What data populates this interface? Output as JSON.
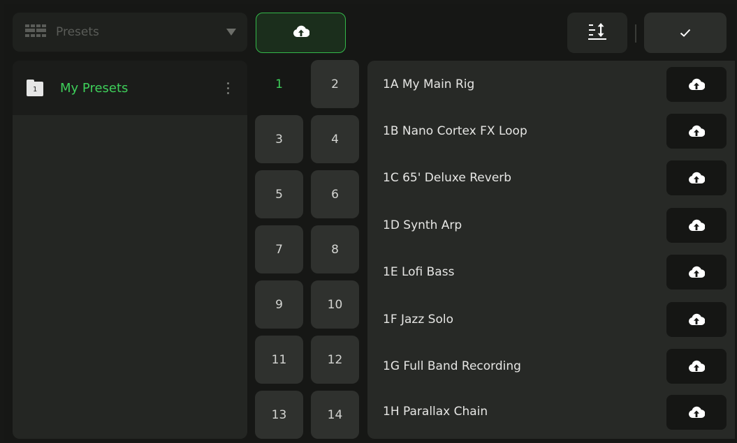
{
  "toolbar": {
    "preset_dropdown_label": "Presets",
    "grid_icon": "preset-grid-icon",
    "upload_icon": "cloud-upload-icon",
    "sort_icon": "sort-icon",
    "confirm_icon": "checkmark-icon"
  },
  "folders": [
    {
      "number": "1",
      "name": "My Presets"
    }
  ],
  "banks": [
    "1",
    "2",
    "3",
    "4",
    "5",
    "6",
    "7",
    "8",
    "9",
    "10",
    "11",
    "12",
    "13",
    "14"
  ],
  "selected_bank": "1",
  "presets": [
    {
      "label": "1A My Main Rig"
    },
    {
      "label": "1B Nano Cortex FX Loop"
    },
    {
      "label": "1C 65' Deluxe Reverb"
    },
    {
      "label": "1D Synth Arp"
    },
    {
      "label": "1E Lofi Bass"
    },
    {
      "label": "1F Jazz Solo"
    },
    {
      "label": "1G Full Band Recording"
    },
    {
      "label": "1H Parallax Chain"
    }
  ],
  "colors": {
    "accent_green": "#3ecf5a",
    "background": "#171816",
    "panel": "#272926"
  }
}
